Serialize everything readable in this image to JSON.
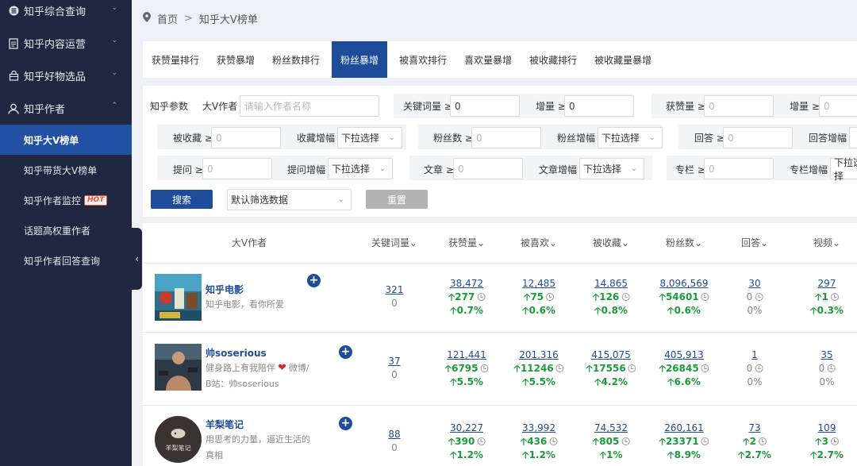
{
  "sidebar": {
    "groups": [
      {
        "label": "知乎综合查询",
        "icon": "database-icon"
      },
      {
        "label": "知乎内容运营",
        "icon": "document-icon"
      },
      {
        "label": "知乎好物选品",
        "icon": "bag-icon"
      },
      {
        "label": "知乎作者",
        "icon": "user-icon"
      }
    ],
    "items": [
      {
        "label": "知乎大V榜单"
      },
      {
        "label": "知乎带货大V榜单"
      },
      {
        "label": "知乎作者监控",
        "badge": "HOT"
      },
      {
        "label": "话题高权重作者"
      },
      {
        "label": "知乎作者回答查询"
      }
    ]
  },
  "breadcrumb": {
    "home": "首页",
    "sep": ">",
    "current": "知乎大V榜单"
  },
  "tabs": [
    "获赞量排行",
    "获赞暴增",
    "粉丝数排行",
    "粉丝暴增",
    "被喜欢排行",
    "喜欢量暴增",
    "被收藏排行",
    "被收藏量暴增"
  ],
  "filters": {
    "section_label": "知乎参数",
    "author_label": "大V作者",
    "author_placeholder": "请输入作者名称",
    "keyword_label": "关键词量 ≥",
    "keyword_value": "0",
    "increase_label": "增量 ≥",
    "increase_value": "0",
    "likes_label": "获赞量 ≥",
    "likes_ph": "0",
    "increase2_label": "增量 ≥",
    "increase2_ph": "0",
    "fav_label": "被收藏 ≥",
    "fav_ph": "0",
    "fav_growth_label": "收藏增幅",
    "select_ph": "下拉选择",
    "fans_label": "粉丝数 ≥",
    "fans_ph": "0",
    "fans_growth_label": "粉丝增幅",
    "answer_label": "回答 ≥",
    "answer_ph": "0",
    "answer_growth_label": "回答增幅",
    "question_label": "提问 ≥",
    "question_ph": "0",
    "question_growth_label": "提问增幅",
    "article_label": "文章 ≥",
    "article_ph": "0",
    "article_growth_label": "文章增幅",
    "column_label": "专栏 ≥",
    "column_ph": "0",
    "column_growth_label": "专栏增幅",
    "search_btn": "搜索",
    "preset_select": "默认筛选数据",
    "reset_btn": "重置"
  },
  "table": {
    "headers": [
      "大V作者",
      "关键词量",
      "获赞量",
      "被喜欢",
      "被收藏",
      "粉丝数",
      "回答",
      "视频"
    ],
    "rows": [
      {
        "name": "知乎电影",
        "desc": "知乎电影，看你所爱",
        "keyword": {
          "v": "321",
          "s": "0"
        },
        "likes": {
          "v": "38,472",
          "d": "277",
          "p": "0.7%"
        },
        "loved": {
          "v": "12,485",
          "d": "75",
          "p": "0.6%"
        },
        "fav": {
          "v": "14,865",
          "d": "126",
          "p": "0.8%"
        },
        "fans": {
          "v": "8,096,569",
          "d": "54601",
          "p": "0.6%"
        },
        "answers": {
          "v": "30",
          "d": "0",
          "p": "0%"
        },
        "videos": {
          "v": "297",
          "d": "1",
          "p": "0.3%"
        }
      },
      {
        "name": "帅soserious",
        "desc1": "健身路上有我陪伴",
        "desc1b": "微博/",
        "desc2": "B站：帅soserious",
        "keyword": {
          "v": "37",
          "s": "0"
        },
        "likes": {
          "v": "121,441",
          "d": "6795",
          "p": "5.5%"
        },
        "loved": {
          "v": "201,316",
          "d": "11246",
          "p": "5.5%"
        },
        "fav": {
          "v": "415,075",
          "d": "17556",
          "p": "4.2%"
        },
        "fans": {
          "v": "405,913",
          "d": "26845",
          "p": "6.6%"
        },
        "answers": {
          "v": "1",
          "d": "0",
          "p": "0%"
        },
        "videos": {
          "v": "35",
          "d": "0",
          "p": "0%"
        }
      },
      {
        "name": "羊梨笔记",
        "avatar_text": "羊梨笔记",
        "desc1": "用思考的力量，逼近生活的",
        "desc2": "真相",
        "keyword": {
          "v": "88",
          "s": "0"
        },
        "likes": {
          "v": "30,227",
          "d": "390",
          "p": "1.2%"
        },
        "loved": {
          "v": "33,992",
          "d": "436",
          "p": "1.2%"
        },
        "fav": {
          "v": "74,532",
          "d": "805",
          "p": "1%"
        },
        "fans": {
          "v": "260,161",
          "d": "23371",
          "p": "8.9%"
        },
        "answers": {
          "v": "73",
          "d": "2",
          "p": "2.7%"
        },
        "videos": {
          "v": "109",
          "d": "3",
          "p": "2.7%"
        }
      }
    ]
  },
  "colors": {
    "sidebar": "#1f2741",
    "accent": "#1f4c99",
    "up": "#1a9b3a"
  }
}
